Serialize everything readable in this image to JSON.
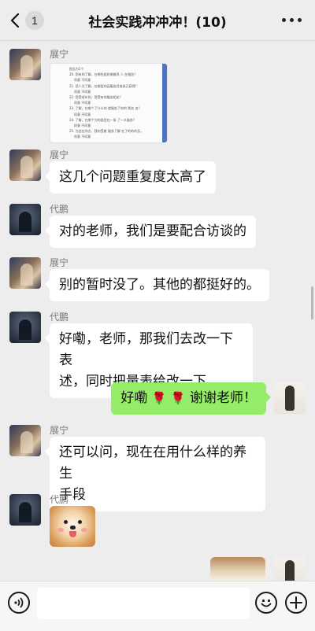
{
  "header": {
    "title": "社会实践冲冲冲！(10)",
    "unread_count": "1",
    "back_icon": "chevron-left-icon",
    "more_icon": "more-dots-icon"
  },
  "messages": [
    {
      "sender": "展宁",
      "type": "image",
      "image_name": "document-screenshot"
    },
    {
      "sender": "展宁",
      "type": "text",
      "text": "这几个问题重复度太高了"
    },
    {
      "sender": "代鹏",
      "type": "text",
      "text": "对的老师，我们是要配合访谈的"
    },
    {
      "sender": "展宁",
      "type": "text",
      "text": "别的暂时没了。其他的都挺好的。"
    },
    {
      "sender": "代鹏",
      "type": "text",
      "text_line1": "好嘞，老师，那我们去改一下表",
      "text_line2": "述，同时把量表给改一下"
    },
    {
      "sender": "me",
      "type": "text",
      "text_a": "好嘞",
      "text_b": "谢谢老师！",
      "emoji": "rose"
    },
    {
      "sender": "展宁",
      "type": "text",
      "text_line1": "还可以问，现在在用什么样的养生",
      "text_line2": "手段"
    },
    {
      "sender": "代鹏",
      "type": "sticker",
      "sticker_name": "shiba-dog-sticker"
    },
    {
      "sender": "me",
      "type": "sticker",
      "sticker_name": "dog-sticker"
    }
  ],
  "doc_preview_lines": [
    "报告为1个",
    "20. 您有的了解，在哪些组织做着养 人 在服务？",
    "同意 不同意",
    "21. 您人为了解，在哪里的因服务目前具已获得？",
    "同意 不同意",
    "22. 您受老年的，您受有你服务相关？",
    "同意 不同意",
    "23. 了解，在哪个了什么的 就服务了你的 到务 务？",
    "同意 不同意",
    "24. 了解，在哪个为的类型在一条 了一么服务？",
    "同意 不同意",
    "25. 为此在你方，我的受着 服务了解 在了的的的及。",
    "同意 不同意"
  ],
  "input_bar": {
    "voice_icon": "voice-icon",
    "emoji_icon": "emoji-icon",
    "plus_icon": "plus-icon",
    "input_value": ""
  },
  "colors": {
    "background": "#ededed",
    "my_bubble": "#95ec69",
    "other_bubble": "#ffffff",
    "sender_name": "#7a7a7a"
  }
}
